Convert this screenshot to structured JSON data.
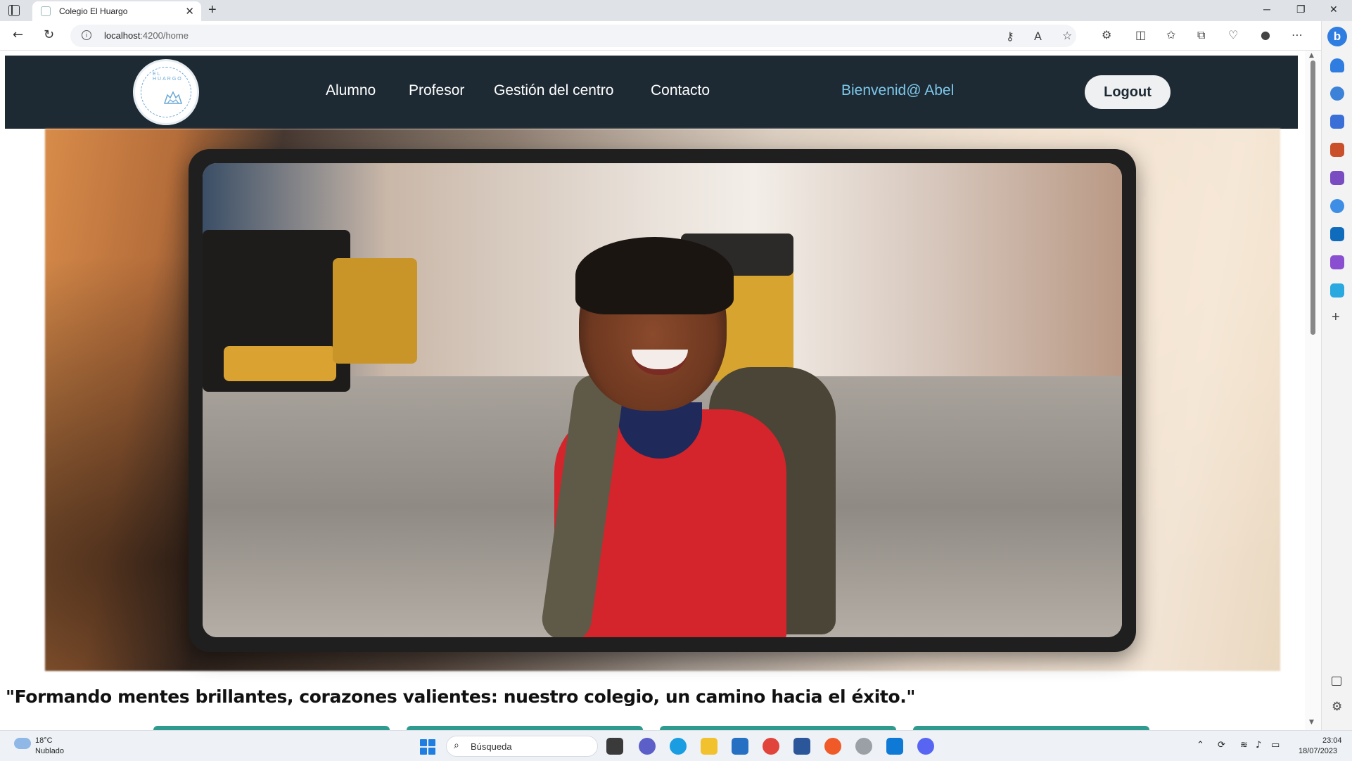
{
  "browser": {
    "tab_title": "Colegio El Huargo",
    "url_host": "localhost",
    "url_path": ":4200/home"
  },
  "site": {
    "logo_text": "EL HUARGO",
    "nav": [
      {
        "label": "Alumno"
      },
      {
        "label": "Profesor"
      },
      {
        "label": "Gestión del centro"
      },
      {
        "label": "Contacto"
      }
    ],
    "welcome": "Bienvenid@ Abel",
    "logout_label": "Logout",
    "accent_color": "#7cc8ec",
    "header_color": "#1e2a33"
  },
  "hero": {
    "image_subject": "smiling schoolgirl with backpack on street"
  },
  "slogan": "\"Formando mentes brillantes, corazones valientes: nuestro colegio, un camino hacia el éxito.\"",
  "taskbar": {
    "weather_temp": "18°C",
    "weather_desc": "Nublado",
    "search_placeholder": "Búsqueda",
    "time": "23:04",
    "date": "18/07/2023"
  }
}
